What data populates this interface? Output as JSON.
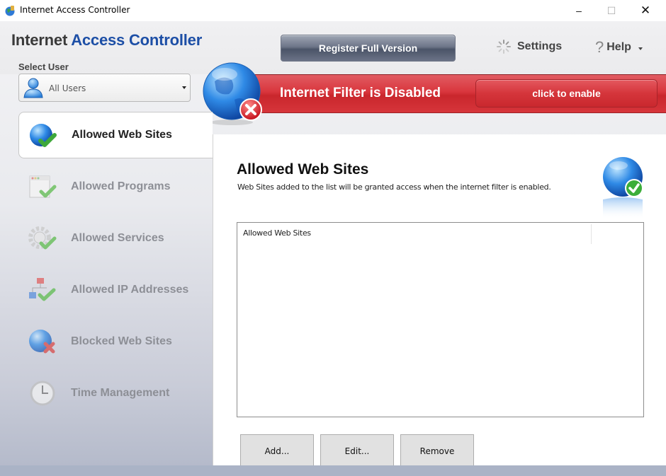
{
  "window": {
    "title": "Internet Access Controller",
    "controls": {
      "minimize": "–",
      "maximize": "☐",
      "close": "✕"
    }
  },
  "header": {
    "brand_part1": "Internet",
    "brand_part2": "Access Controller",
    "select_user_label": "Select User",
    "selected_user": "All Users",
    "register_label": "Register Full Version",
    "settings_label": "Settings",
    "help_q": "?",
    "help_label": "Help"
  },
  "status": {
    "text": "Internet Filter is Disabled",
    "enable_label": "click to enable",
    "color": "#d9363d"
  },
  "sidebar": {
    "items": [
      {
        "label": "Allowed Web Sites",
        "icon": "globe-check-icon",
        "active": true
      },
      {
        "label": "Allowed Programs",
        "icon": "window-check-icon",
        "active": false
      },
      {
        "label": "Allowed Services",
        "icon": "gear-check-icon",
        "active": false
      },
      {
        "label": "Allowed IP Addresses",
        "icon": "network-check-icon",
        "active": false
      },
      {
        "label": "Blocked Web Sites",
        "icon": "globe-x-icon",
        "active": false
      },
      {
        "label": "Time Management",
        "icon": "clock-icon",
        "active": false
      }
    ]
  },
  "main": {
    "title": "Allowed Web Sites",
    "description": "Web Sites added to the list will be granted access when the internet filter is enabled.",
    "list": {
      "column_header": "Allowed Web Sites",
      "rows": []
    },
    "buttons": {
      "add": "Add...",
      "edit": "Edit...",
      "remove": "Remove"
    }
  }
}
